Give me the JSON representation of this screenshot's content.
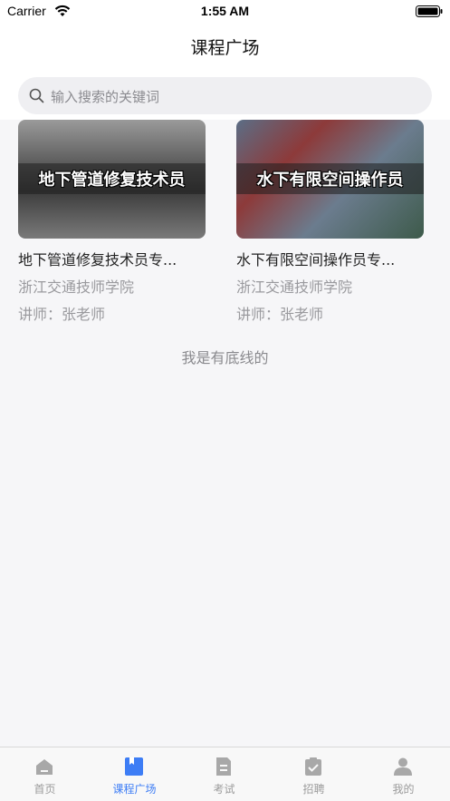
{
  "status_bar": {
    "carrier": "Carrier",
    "time": "1:55 AM"
  },
  "nav": {
    "title": "课程广场"
  },
  "search": {
    "placeholder": "输入搜索的关键词"
  },
  "courses": [
    {
      "thumb_text": "地下管道修复技术员",
      "title": "地下管道修复技术员专...",
      "school": "浙江交通技师学院",
      "teacher": "讲师：张老师"
    },
    {
      "thumb_text": "水下有限空间操作员",
      "title": "水下有限空间操作员专...",
      "school": "浙江交通技师学院",
      "teacher": "讲师：张老师"
    }
  ],
  "list_end": "我是有底线的",
  "tabs": [
    {
      "label": "首页",
      "icon": "home-icon",
      "active": false
    },
    {
      "label": "课程广场",
      "icon": "book-icon",
      "active": true
    },
    {
      "label": "考试",
      "icon": "exam-icon",
      "active": false
    },
    {
      "label": "招聘",
      "icon": "clipboard-check-icon",
      "active": false
    },
    {
      "label": "我的",
      "icon": "user-icon",
      "active": false
    }
  ],
  "colors": {
    "accent": "#3d7df5",
    "inactive": "#9b9b9b",
    "background": "#f6f6f8"
  }
}
